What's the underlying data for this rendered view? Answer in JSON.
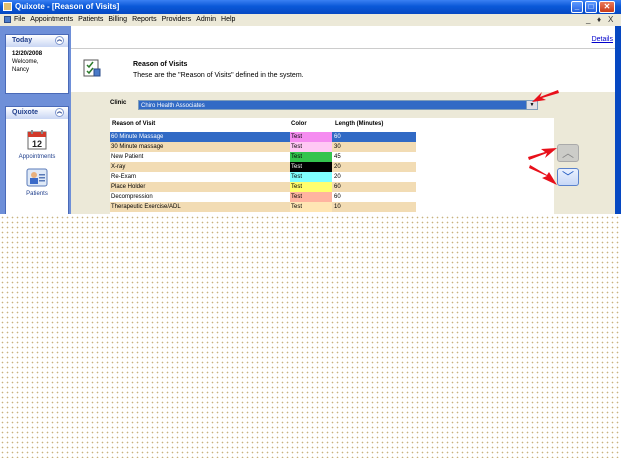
{
  "window": {
    "title": "Quixote - [Reason of Visits]"
  },
  "menu": {
    "items": [
      "File",
      "Appointments",
      "Patients",
      "Billing",
      "Reports",
      "Providers",
      "Admin",
      "Help"
    ],
    "controls": [
      "_",
      "♦",
      "X"
    ]
  },
  "sidebar": {
    "today": {
      "header": "Today",
      "date": "12/20/2008",
      "welcome": "Welcome,",
      "user": "Nancy"
    },
    "quixote": {
      "header": "Quixote",
      "items": [
        {
          "label": "Appointments",
          "icon": "calendar-icon",
          "badge": "12"
        },
        {
          "label": "Patients",
          "icon": "patients-icon"
        }
      ]
    }
  },
  "header": {
    "details_link": "Details",
    "title": "Reason of Visits",
    "description": "These are the \"Reason of Visits\" defined in the system."
  },
  "clinic": {
    "label": "Clinic",
    "selected": "Chiro Health Associates"
  },
  "table": {
    "columns": [
      "Reason of Visit",
      "Color",
      "Length (Minutes)"
    ],
    "rows": [
      {
        "reason": "60 Minute Massage",
        "color_label": "Test",
        "color": "#f58cf0",
        "length": "60",
        "selected": true
      },
      {
        "reason": "30 Minute massage",
        "color_label": "Test",
        "color": "#ffc8f4",
        "length": "30"
      },
      {
        "reason": "New Patient",
        "color_label": "Test",
        "color": "#34c44e",
        "length": "45"
      },
      {
        "reason": "X-ray",
        "color_label": "Test",
        "color": "#000000",
        "length": "20",
        "dark": true
      },
      {
        "reason": "Re-Exam",
        "color_label": "Test",
        "color": "#80ffff",
        "length": "20"
      },
      {
        "reason": "Place Holder",
        "color_label": "Test",
        "color": "#ffff6e",
        "length": "60"
      },
      {
        "reason": "Decompression",
        "color_label": "Test",
        "color": "#ffb4a0",
        "length": "60"
      },
      {
        "reason": "Therapeutic Exercise/ADL",
        "color_label": "Test",
        "color": "#ffe6b4",
        "length": "10"
      }
    ]
  },
  "colors": {
    "titlebar": "#0a58d8",
    "sidebar": "#6e8fd8",
    "selection": "#316ac5",
    "row_alt": "#f2dcb4",
    "arrow": "#e8101a"
  }
}
